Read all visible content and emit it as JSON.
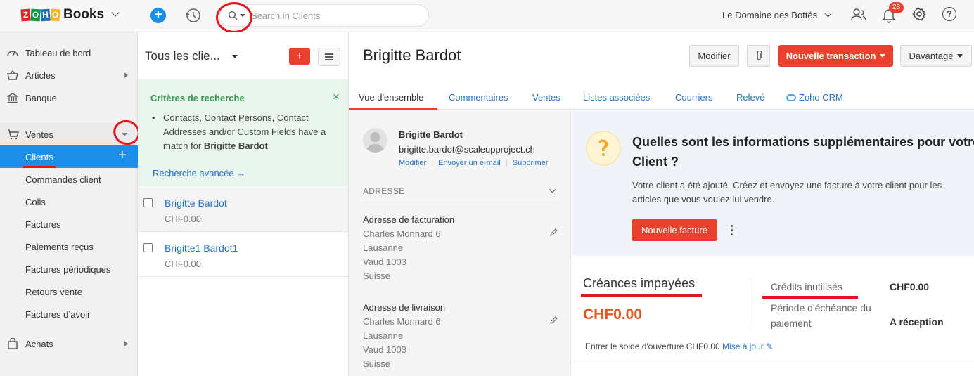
{
  "topbar": {
    "logo_letters": [
      "Z",
      "O",
      "H",
      "O"
    ],
    "logo_colors": [
      "#e42527",
      "#089949",
      "#226db4",
      "#f9b21d"
    ],
    "app_name": "Books",
    "search_placeholder": "Search in Clients",
    "org_name": "Le Domaine des Bottés",
    "notification_count": "28"
  },
  "sidebar": {
    "items": [
      {
        "label": "Tableau de bord",
        "icon": "dashboard-icon"
      },
      {
        "label": "Articles",
        "icon": "basket-icon"
      },
      {
        "label": "Banque",
        "icon": "bank-icon"
      },
      {
        "label": "Ventes",
        "icon": "cart-icon"
      }
    ],
    "ventes_sub": [
      "Clients",
      "Commandes client",
      "Colis",
      "Factures",
      "Paiements reçus",
      "Factures périodiques",
      "Retours vente",
      "Factures d’avoir"
    ],
    "achats_label": "Achats"
  },
  "list": {
    "title": "Tous les clie...",
    "criteria": {
      "title": "Critères de recherche",
      "text": "Contacts, Contact Persons, Contact Addresses and/or Custom Fields have a match for",
      "term": "Brigitte Bardot",
      "advanced_link": "Recherche avancée"
    },
    "rows": [
      {
        "name": "Brigitte Bardot",
        "amount": "CHF0.00"
      },
      {
        "name": "Brigitte1 Bardot1",
        "amount": "CHF0.00"
      }
    ]
  },
  "detail": {
    "name": "Brigitte Bardot",
    "buttons": {
      "edit": "Modifier",
      "new_transaction": "Nouvelle transaction",
      "more": "Davantage"
    },
    "tabs": [
      "Vue d'ensemble",
      "Commentaires",
      "Ventes",
      "Listes associées",
      "Courriers",
      "Relevé",
      "Zoho CRM"
    ],
    "contact": {
      "name": "Brigitte Bardot",
      "email": "brigitte.bardot@scaleupproject.ch",
      "actions": [
        "Modifier",
        "Envoyer un e-mail",
        "Supprimer"
      ]
    },
    "address_header": "ADRESSE",
    "billing": {
      "label": "Adresse de facturation",
      "lines": [
        "Charles Monnard 6",
        "Lausanne",
        "Vaud 1003",
        "Suisse"
      ]
    },
    "shipping": {
      "label": "Adresse de livraison",
      "lines": [
        "Charles Monnard 6",
        "Lausanne",
        "Vaud 1003",
        "Suisse"
      ]
    },
    "info_card": {
      "title_line1": "Quelles sont les informations supplémentaires pour votre",
      "title_line2": "Client ?",
      "text_line1": "Votre client a été ajouté. Créez et envoyez une facture à votre client pour les",
      "text_line2": "articles que vous voulez lui vendre.",
      "button": "Nouvelle facture"
    },
    "receivables": {
      "label": "Créances impayées",
      "value": "CHF0.00",
      "credits_label": "Crédits inutilisés",
      "credits_value": "CHF0.00",
      "term_label_line1": "Période d'échéance du",
      "term_label_line2": "paiement",
      "term_value": "A réception"
    },
    "opening_balance": {
      "text": "Entrer le solde d'ouverture CHF0.00",
      "link": "Mise à jour"
    }
  },
  "colors": {
    "accent_blue": "#1d8ee6",
    "brand_red": "#e8412d",
    "annotation_red": "#e6141b",
    "link_blue": "#2573c9"
  }
}
